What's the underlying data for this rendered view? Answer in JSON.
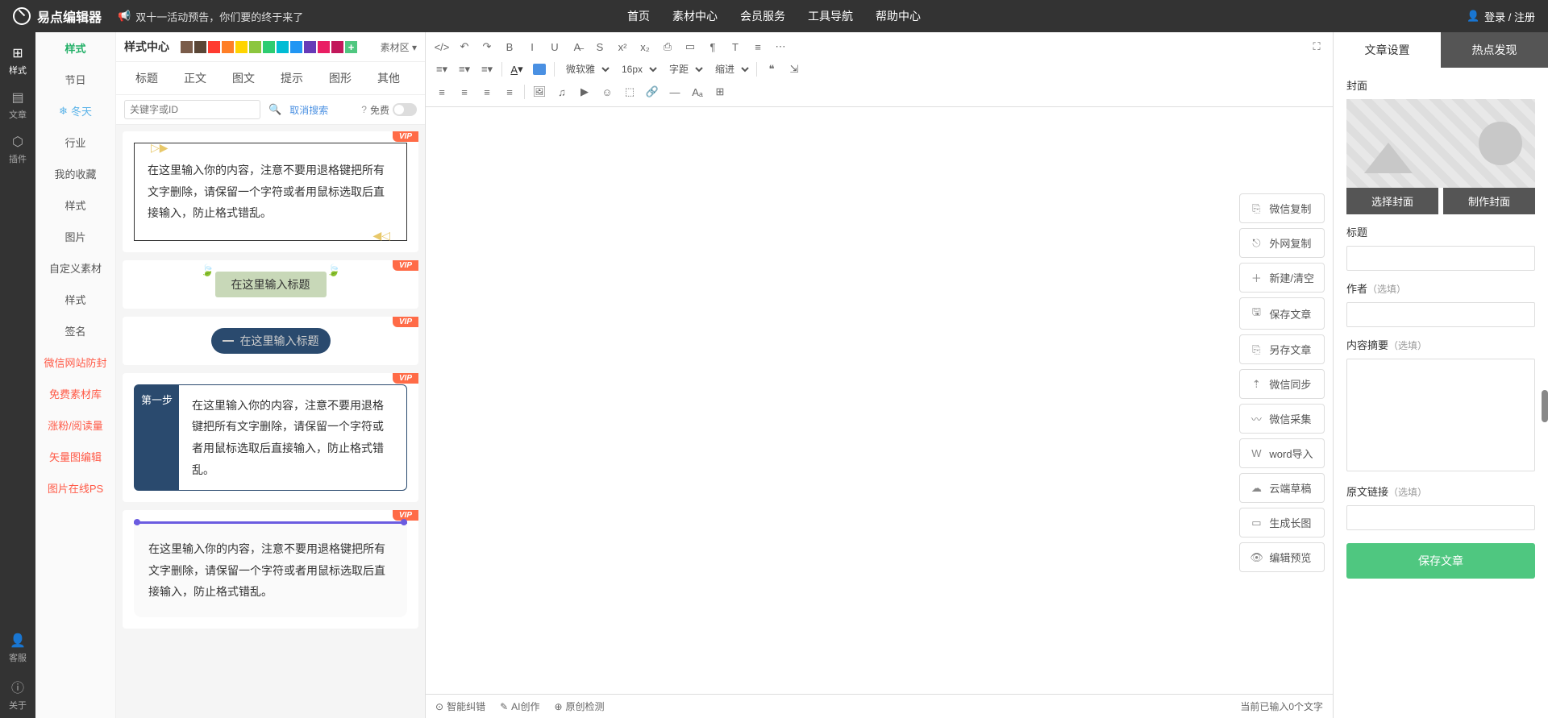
{
  "topbar": {
    "logo": "易点编辑器",
    "promo": "双十一活动预告，你们要的终于来了",
    "nav": [
      "首页",
      "素材中心",
      "会员服务",
      "工具导航",
      "帮助中心"
    ],
    "login": "登录 / 注册"
  },
  "rail": {
    "items": [
      {
        "icon": "⊞",
        "label": "样式"
      },
      {
        "icon": "▤",
        "label": "文章"
      },
      {
        "icon": "⬡",
        "label": "插件"
      }
    ],
    "bottom": [
      {
        "icon": "👤",
        "label": "客服"
      },
      {
        "icon": "ⓘ",
        "label": "关于"
      }
    ]
  },
  "sub_sidebar": [
    {
      "label": "样式",
      "cls": "active"
    },
    {
      "label": "节日",
      "cls": ""
    },
    {
      "label": "冬天",
      "cls": "winter",
      "icon": "❄"
    },
    {
      "label": "行业",
      "cls": ""
    },
    {
      "label": "我的收藏",
      "cls": ""
    },
    {
      "label": "样式",
      "cls": ""
    },
    {
      "label": "图片",
      "cls": ""
    },
    {
      "label": "自定义素材",
      "cls": ""
    },
    {
      "label": "样式",
      "cls": ""
    },
    {
      "label": "签名",
      "cls": ""
    },
    {
      "label": "微信网站防封",
      "cls": "red"
    },
    {
      "label": "免费素材库",
      "cls": "red"
    },
    {
      "label": "涨粉/阅读量",
      "cls": "red"
    },
    {
      "label": "矢量图编辑",
      "cls": "red"
    },
    {
      "label": "图片在线PS",
      "cls": "red"
    }
  ],
  "style_center": {
    "title": "样式中心",
    "colors": [
      "#7a5c4a",
      "#5a4636",
      "#ff3b30",
      "#ff7f27",
      "#ffd400",
      "#8cc63f",
      "#2ecc71",
      "#00bcd4",
      "#2196f3",
      "#673ab7",
      "#e91e63",
      "#c2185b"
    ],
    "add_color": "+",
    "dropdown": "素材区 ▾",
    "tabs": [
      "标题",
      "正文",
      "图文",
      "提示",
      "图形",
      "其他"
    ],
    "search_ph": "关键字或ID",
    "cancel": "取消搜索",
    "free_label": "免费",
    "vip": "VIP",
    "tpl_text_long": "在这里输入你的内容，注意不要用退格键把所有文字删除，请保留一个字符或者用鼠标选取后直接输入，防止格式错乱。",
    "tpl_title": "在这里输入标题",
    "tpl_step": "第一步"
  },
  "toolbar": {
    "row1": [
      "</>",
      "↶",
      "↷",
      "B",
      "I",
      "U",
      "A̶",
      "S",
      "x²",
      "x₂",
      "⎙",
      "▭",
      "¶",
      "T",
      "≡",
      "⋯",
      "⛶"
    ],
    "row2_sel": [
      "微软雅",
      "16px",
      "字距",
      "缩进"
    ],
    "row2_end": [
      "❝",
      "⇲"
    ],
    "row3": [
      "≡",
      "≡",
      "≡",
      "≡",
      "|",
      "🖼",
      "♫",
      "▶",
      "☺",
      "⬚",
      "🔗",
      "—",
      "Aₐ",
      "⊞"
    ]
  },
  "side_tools": [
    {
      "icon": "⎘",
      "label": "微信复制"
    },
    {
      "icon": "⎋",
      "label": "外网复制"
    },
    {
      "icon": "＋",
      "label": "新建/清空"
    },
    {
      "icon": "🖫",
      "label": "保存文章"
    },
    {
      "icon": "⎘",
      "label": "另存文章"
    },
    {
      "icon": "⇡",
      "label": "微信同步"
    },
    {
      "icon": "〰",
      "label": "微信采集"
    },
    {
      "icon": "W",
      "label": "word导入"
    },
    {
      "icon": "☁",
      "label": "云端草稿"
    },
    {
      "icon": "▭",
      "label": "生成长图"
    },
    {
      "icon": "👁",
      "label": "编辑预览"
    }
  ],
  "footer": {
    "items": [
      {
        "icon": "⊙",
        "label": "智能纠错"
      },
      {
        "icon": "✎",
        "label": "AI创作"
      },
      {
        "icon": "⊕",
        "label": "原创检测"
      }
    ],
    "count": "当前已输入0个文字"
  },
  "right": {
    "tabs": [
      "文章设置",
      "热点发现"
    ],
    "cover_label": "封面",
    "choose_cover": "选择封面",
    "make_cover": "制作封面",
    "title_label": "标题",
    "author_label": "作者",
    "optional": "（选填）",
    "summary_label": "内容摘要",
    "source_label": "原文链接",
    "save": "保存文章"
  }
}
